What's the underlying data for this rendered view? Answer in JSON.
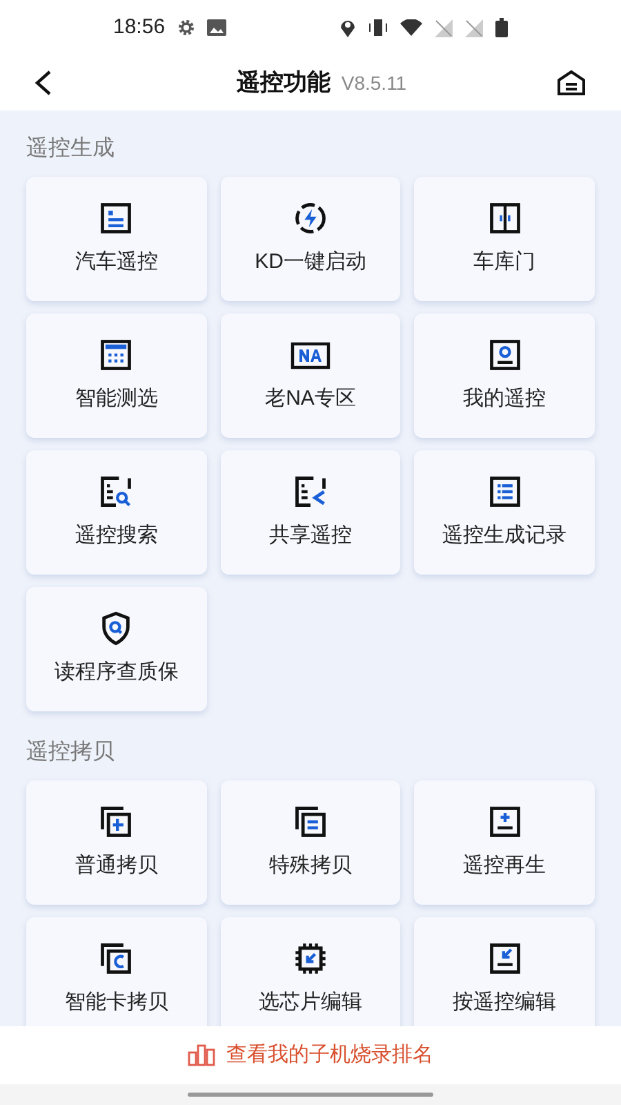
{
  "status_bar": {
    "time": "18:56"
  },
  "header": {
    "title": "遥控功能",
    "version": "V8.5.11"
  },
  "sections": [
    {
      "title": "遥控生成",
      "items": [
        {
          "label": "汽车遥控"
        },
        {
          "label": "KD一键启动"
        },
        {
          "label": "车库门"
        },
        {
          "label": "智能测选"
        },
        {
          "label": "老NA专区"
        },
        {
          "label": "我的遥控"
        },
        {
          "label": "遥控搜索"
        },
        {
          "label": "共享遥控"
        },
        {
          "label": "遥控生成记录"
        },
        {
          "label": "读程序查质保"
        }
      ]
    },
    {
      "title": "遥控拷贝",
      "items": [
        {
          "label": "普通拷贝"
        },
        {
          "label": "特殊拷贝"
        },
        {
          "label": "遥控再生"
        },
        {
          "label": "智能卡拷贝"
        },
        {
          "label": "选芯片编辑"
        },
        {
          "label": "按遥控编辑"
        }
      ]
    }
  ],
  "bottom_link": {
    "label": "查看我的子机烧录排名"
  }
}
